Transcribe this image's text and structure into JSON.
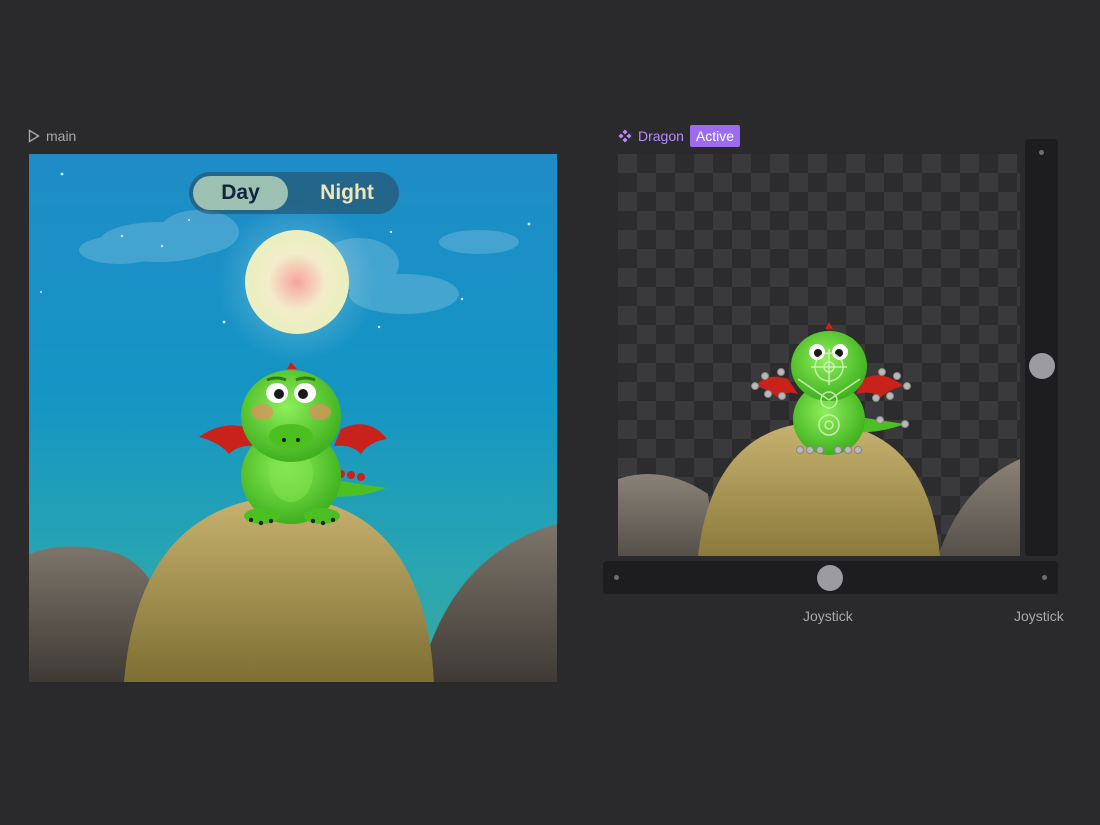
{
  "main_frame": {
    "label": "main",
    "icon": "play-triangle-icon"
  },
  "toggle": {
    "day": "Day",
    "night": "Night"
  },
  "component": {
    "name": "Dragon",
    "icon": "component-diamond-icon",
    "status": "Active"
  },
  "joysticks": {
    "horizontal_label": "Joystick",
    "vertical_label": "Joystick",
    "horizontal_value": 0.5,
    "vertical_value": 0.54
  },
  "colors": {
    "accent": "#9b6cf0",
    "component": "#b68cff",
    "background": "#2a292c",
    "sky_top": "#1f8cc7",
    "dragon_green": "#5fd22e",
    "wing_red": "#c8221a"
  }
}
